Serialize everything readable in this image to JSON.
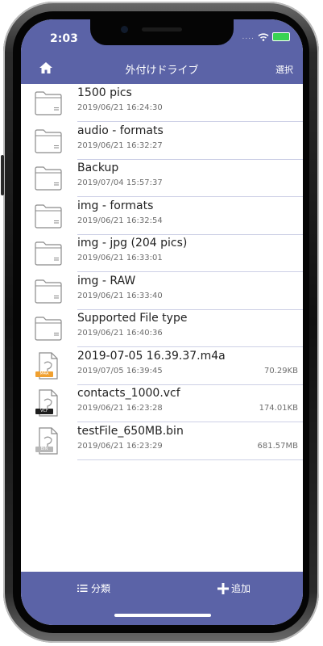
{
  "status": {
    "time": "2:03",
    "signal_dots": "....",
    "battery_color": "#39d353"
  },
  "header": {
    "title": "外付けドライブ",
    "select_label": "選択",
    "home_icon": "home-icon"
  },
  "files": [
    {
      "name": "1500 pics",
      "date": "2019/06/21 16:24:30",
      "size": "",
      "type": "folder"
    },
    {
      "name": "audio - formats",
      "date": "2019/06/21 16:32:27",
      "size": "",
      "type": "folder"
    },
    {
      "name": "Backup",
      "date": "2019/07/04 15:57:37",
      "size": "",
      "type": "folder"
    },
    {
      "name": "img - formats",
      "date": "2019/06/21 16:32:54",
      "size": "",
      "type": "folder"
    },
    {
      "name": "img - jpg (204 pics)",
      "date": "2019/06/21 16:33:01",
      "size": "",
      "type": "folder"
    },
    {
      "name": "img - RAW",
      "date": "2019/06/21 16:33:40",
      "size": "",
      "type": "folder"
    },
    {
      "name": "Supported File type",
      "date": "2019/06/21 16:40:36",
      "size": "",
      "type": "folder"
    },
    {
      "name": "2019-07-05 16.39.37.m4a",
      "date": "2019/07/05 16:39:45",
      "size": "70.29KB",
      "type": "file",
      "badge": "M4A",
      "badge_color": "#f0a030"
    },
    {
      "name": "contacts_1000.vcf",
      "date": "2019/06/21 16:23:28",
      "size": "174.01KB",
      "type": "file",
      "badge": "VCF",
      "badge_color": "#1e1e1e"
    },
    {
      "name": "testFile_650MB.bin",
      "date": "2019/06/21 16:23:29",
      "size": "681.57MB",
      "type": "file",
      "badge": "BIN",
      "badge_color": "#b8b8b8"
    }
  ],
  "footer": {
    "category_label": "分類",
    "add_label": "追加"
  },
  "colors": {
    "accent": "#5b63a7",
    "divider": "#cdd0e6"
  }
}
